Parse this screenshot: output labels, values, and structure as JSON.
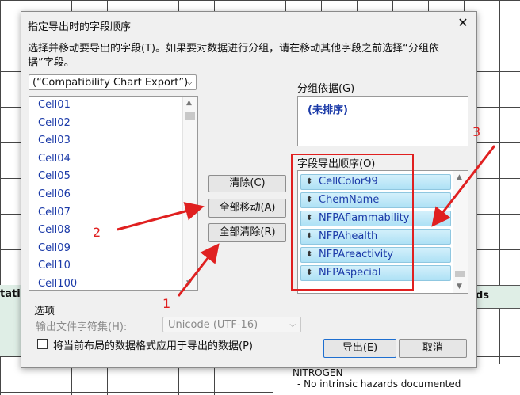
{
  "background": {
    "left_header_text": "tatic",
    "right_header_text": "ds",
    "bottom_line1": "NITROGEN",
    "bottom_line2": "- No intrinsic hazards documented"
  },
  "dialog": {
    "title": "指定导出时的字段顺序",
    "close_glyph": "✕",
    "description": "选择并移动要导出的字段(T)。如果要对数据进行分组，请在移动其他字段之前选择“分组依据”字段。",
    "source_combo": "(“Compatibility Chart Export”)",
    "fields": [
      "Cell01",
      "Cell02",
      "Cell03",
      "Cell04",
      "Cell05",
      "Cell06",
      "Cell07",
      "Cell08",
      "Cell09",
      "Cell10",
      "Cell100"
    ],
    "buttons": {
      "clear": "清除(C)",
      "move_all": "全部移动(A)",
      "clear_all": "全部清除(R)"
    },
    "group_by_label": "分组依据(G)",
    "group_by_value": "(未排序)",
    "order_label": "字段导出顺序(O)",
    "order_fields": [
      "CellColor99",
      "ChemName",
      "NFPAflammability",
      "NFPAhealth",
      "NFPAreactivity",
      "NFPAspecial"
    ],
    "options_title": "选项",
    "charset_label": "输出文件字符集(H):",
    "charset_value": "Unicode (UTF-16)",
    "apply_format_label": "将当前布局的数据格式应用于导出的数据(P)",
    "export_button": "导出(E)",
    "cancel_button": "取消"
  },
  "annotations": {
    "n1": "1",
    "n2": "2",
    "n3": "3",
    "color": "#e02020"
  }
}
